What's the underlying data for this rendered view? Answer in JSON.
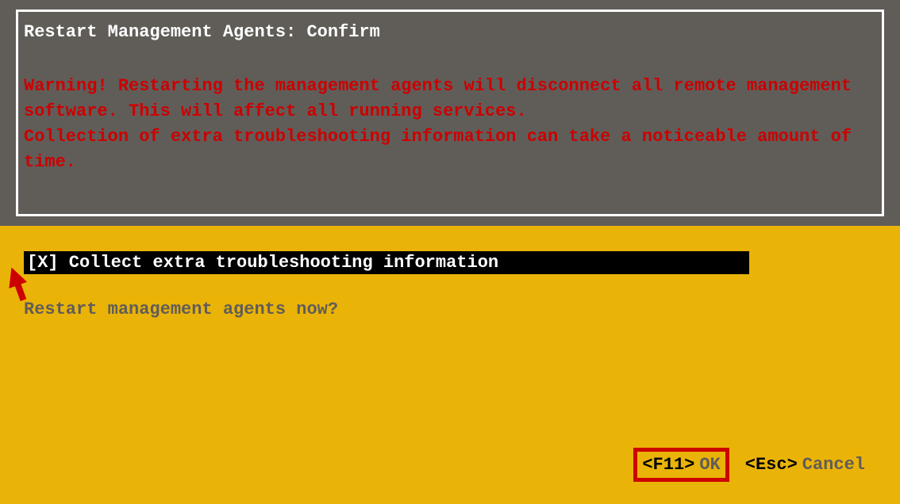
{
  "dialog": {
    "title": "Restart Management Agents: Confirm",
    "warning": "Warning! Restarting the management agents will disconnect all remote management software. This will affect all running services.\nCollection of extra troubleshooting information can take a noticeable amount of time."
  },
  "checkbox": {
    "checked": true,
    "label": "Collect extra troubleshooting information",
    "display": "[X] Collect extra troubleshooting information"
  },
  "prompt": "Restart management agents now?",
  "buttons": {
    "ok": {
      "key": "<F11>",
      "label": "OK"
    },
    "cancel": {
      "key": "<Esc>",
      "label": "Cancel"
    }
  }
}
